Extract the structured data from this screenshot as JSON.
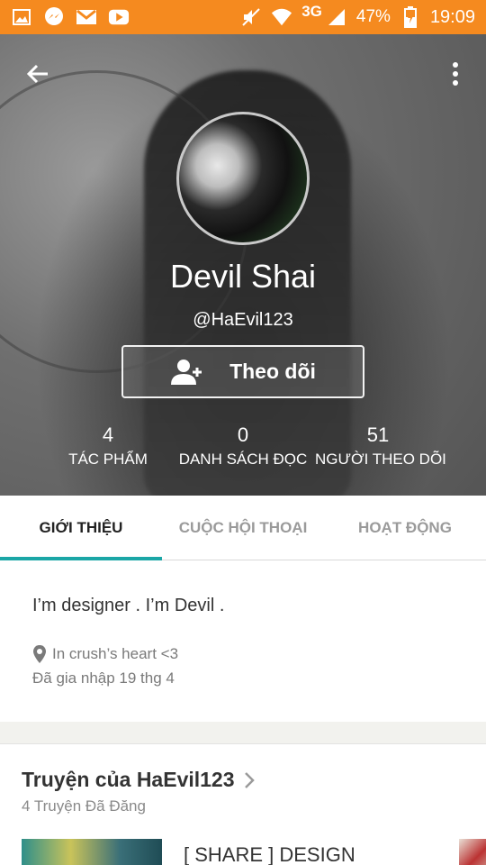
{
  "status_bar": {
    "network": "3G",
    "battery": "47%",
    "time": "19:09",
    "bg_color": "#f58a1f",
    "left_icons": [
      "gallery-icon",
      "messenger-icon",
      "gmail-icon",
      "youtube-icon"
    ],
    "right_icons": [
      "mute-icon",
      "wifi-icon",
      "signal-icon",
      "battery-icon"
    ]
  },
  "profile": {
    "display_name": "Devil Shai",
    "handle": "@HaEvil123",
    "follow_label": "Theo dõi"
  },
  "stats": [
    {
      "value": "4",
      "label": "TÁC PHẨM"
    },
    {
      "value": "0",
      "label": "DANH SÁCH ĐỌC"
    },
    {
      "value": "51",
      "label": "NGƯỜI THEO DÕI"
    }
  ],
  "tabs": [
    {
      "label": "GIỚI THIỆU",
      "active": true
    },
    {
      "label": "CUỘC HỘI THOẠI",
      "active": false
    },
    {
      "label": "HOẠT ĐỘNG",
      "active": false
    }
  ],
  "about": {
    "bio": "I’m designer . I’m Devil .",
    "location": "In crush’s heart <3",
    "joined": "Đã gia nhập 19 thg 4"
  },
  "stories": {
    "title": "Truyện của HaEvil123",
    "subtitle": "4 Truyện Đã Đăng",
    "first_story_title": "[ SHARE ] DESIGN"
  },
  "colors": {
    "accent": "#1aa6a6",
    "status_bar": "#f58a1f"
  }
}
